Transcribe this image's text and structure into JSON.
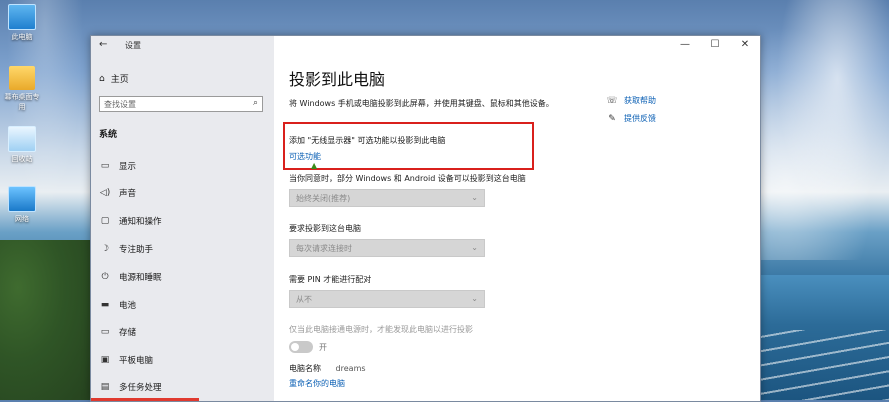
{
  "desktop": {
    "icons": [
      {
        "label": "此电脑",
        "icon": "computer-icon"
      },
      {
        "label": "幕布桌面专用",
        "icon": "folder-icon"
      },
      {
        "label": "回收站",
        "icon": "recycle-bin-icon"
      },
      {
        "label": "网络",
        "icon": "network-icon"
      }
    ]
  },
  "window": {
    "title": "设置",
    "controls": {
      "minimize": "—",
      "maximize": "☐",
      "close": "✕"
    }
  },
  "sidebar": {
    "home": "主页",
    "search_placeholder": "查找设置",
    "section": "系统",
    "items": [
      {
        "label": "显示",
        "icon": "display-icon"
      },
      {
        "label": "声音",
        "icon": "sound-icon"
      },
      {
        "label": "通知和操作",
        "icon": "notification-icon"
      },
      {
        "label": "专注助手",
        "icon": "focus-assist-icon"
      },
      {
        "label": "电源和睡眠",
        "icon": "power-icon"
      },
      {
        "label": "电池",
        "icon": "battery-icon"
      },
      {
        "label": "存储",
        "icon": "storage-icon"
      },
      {
        "label": "平板电脑",
        "icon": "tablet-icon"
      },
      {
        "label": "多任务处理",
        "icon": "multitask-icon"
      }
    ]
  },
  "main": {
    "title": "投影到此电脑",
    "description": "将 Windows 手机或电脑投影到此屏幕，并使用其键盘、鼠标和其他设备。",
    "add_label": "添加 \"无线显示器\" 可选功能以投影到此电脑",
    "optional_link": "可选功能",
    "settings": [
      {
        "label": "当你同意时，部分 Windows 和 Android 设备可以投影到这台电脑",
        "value": "始终关闭(推荐)"
      },
      {
        "label": "要求投影到这台电脑",
        "value": "每次请求连接时"
      },
      {
        "label": "需要 PIN 才能进行配对",
        "value": "从不"
      }
    ],
    "power_label": "仅当此电脑接通电源时，才能发现此电脑以进行投影",
    "toggle_label": "开",
    "pc_name_label": "电脑名称",
    "pc_name_value": "dreams",
    "rename_link": "重命名你的电脑",
    "help": [
      {
        "label": "获取帮助",
        "icon": "help-icon"
      },
      {
        "label": "提供反馈",
        "icon": "feedback-icon"
      }
    ]
  },
  "colors": {
    "accent": "#0a5fb4",
    "highlight": "#d9201c"
  }
}
